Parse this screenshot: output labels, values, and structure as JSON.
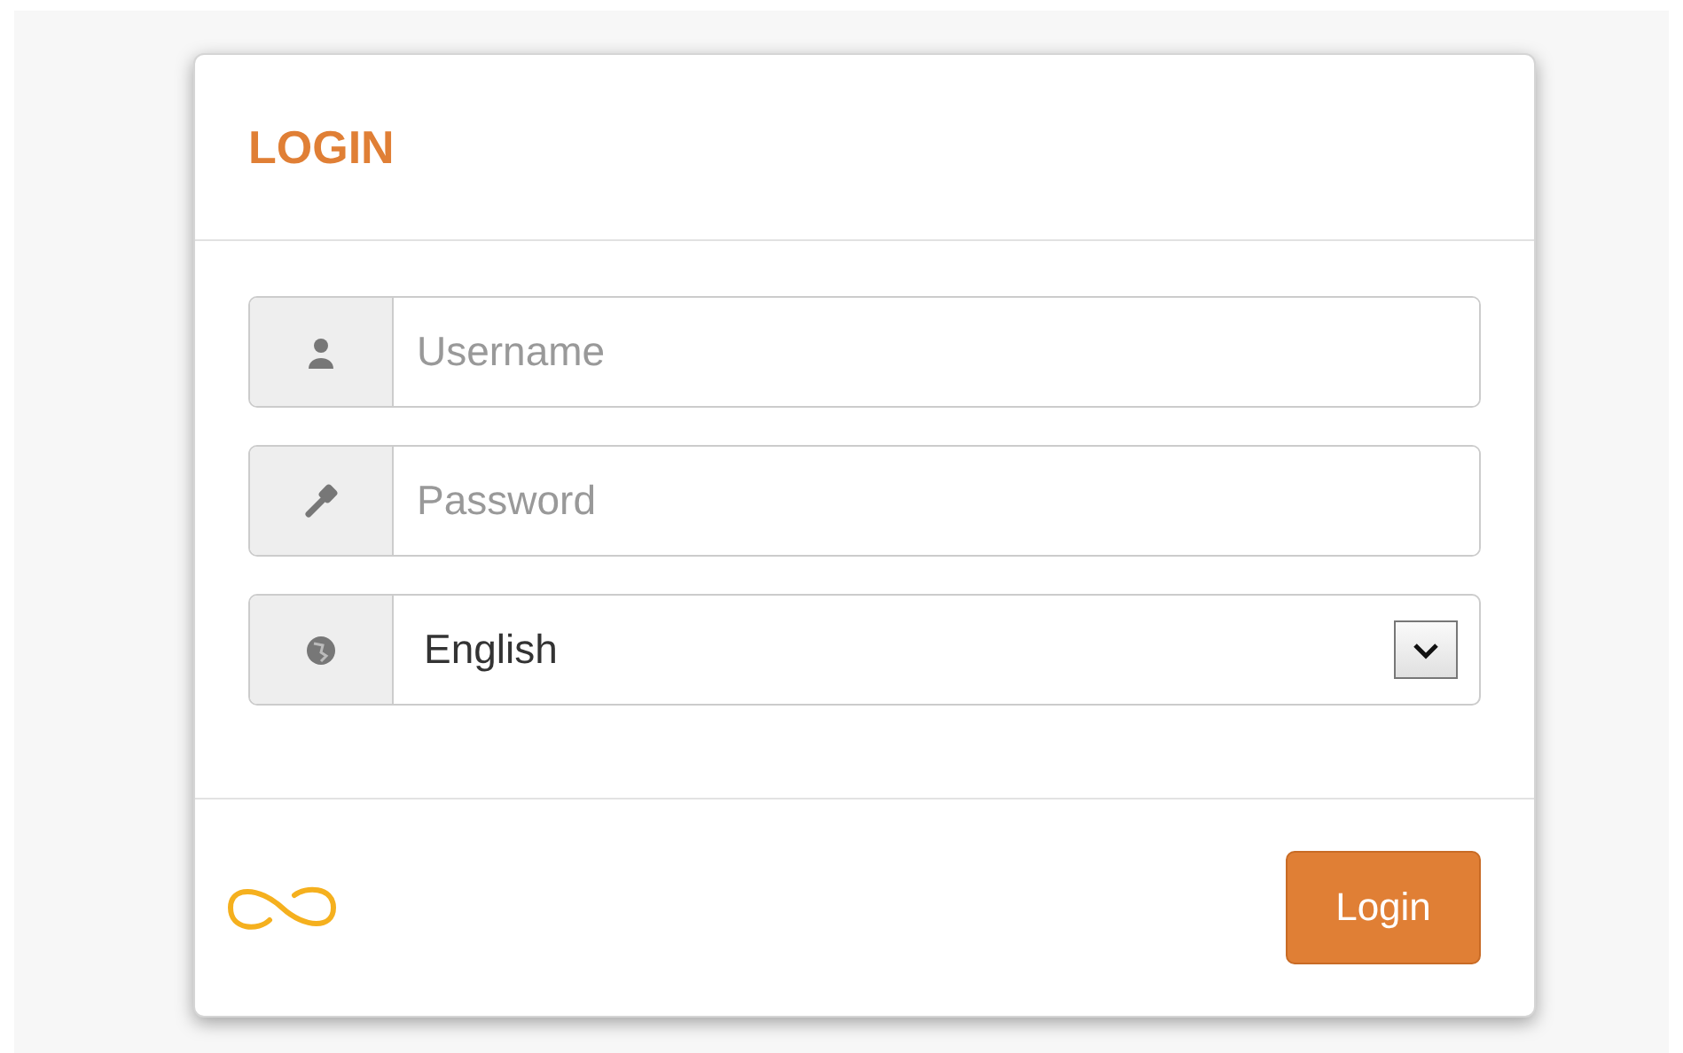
{
  "panel": {
    "title": "LOGIN"
  },
  "fields": [
    {
      "kind": "text",
      "placeholder": "Username"
    },
    {
      "kind": "password",
      "placeholder": "Password"
    },
    {
      "kind": "select",
      "value": "English"
    }
  ],
  "buttons": [
    {
      "label": "Login"
    }
  ]
}
